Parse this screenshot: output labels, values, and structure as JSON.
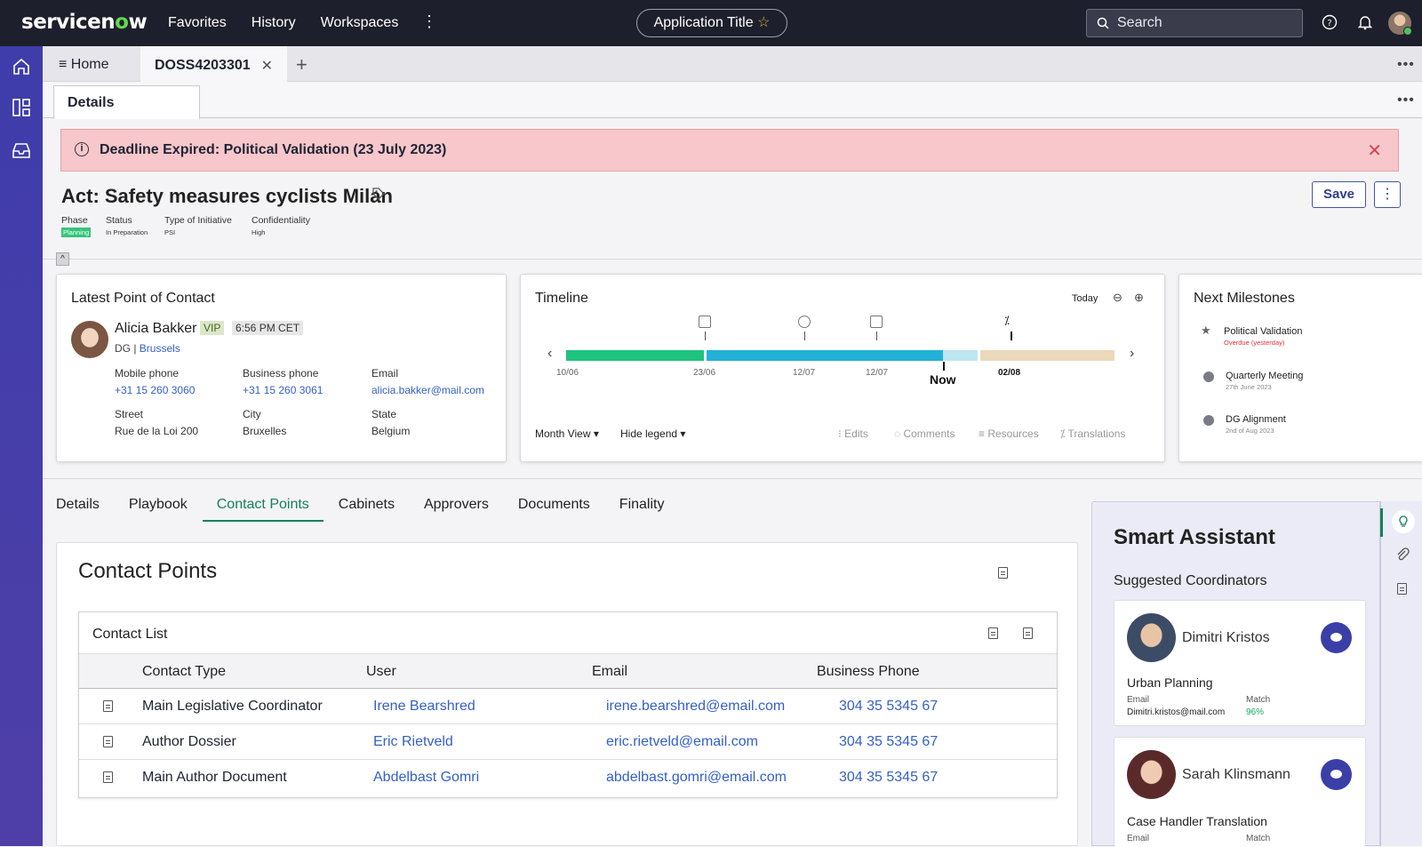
{
  "topbar": {
    "logo_a": "servicen",
    "logo_o": "o",
    "logo_b": "w",
    "nav": [
      "Favorites",
      "History",
      "Workspaces"
    ],
    "app_title": "Application Title",
    "search_placeholder": "Search"
  },
  "tabs": {
    "home": "Home",
    "doc": "DOSS4203301"
  },
  "subtab": "Details",
  "alert": "Deadline Expired: Political Validation (23 July 2023)",
  "act": {
    "title": "Act: Safety measures cyclists Milan",
    "save": "Save",
    "meta": [
      {
        "label": "Phase",
        "value": "Planning"
      },
      {
        "label": "Status",
        "value": "In Preparation"
      },
      {
        "label": "Type of Initiative",
        "value": "PSI"
      },
      {
        "label": "Confidentiality",
        "value": "High"
      }
    ]
  },
  "contact_card": {
    "title": "Latest Point of Contact",
    "name": "Alicia Bakker",
    "vip": "VIP",
    "time": "6:56 PM CET",
    "dept": "DG |",
    "city_link": "Brussels",
    "mobile_label": "Mobile phone",
    "mobile": "+31 15 260 3060",
    "business_label": "Business phone",
    "business": "+31 15 260 3061",
    "email_label": "Email",
    "email": "alicia.bakker@mail.com",
    "street_label": "Street",
    "street": "Rue de la Loi 200",
    "city_label": "City",
    "city": "Bruxelles",
    "state_label": "State",
    "state": "Belgium"
  },
  "timeline": {
    "title": "Timeline",
    "today": "Today",
    "dates": [
      "10/06",
      "23/06",
      "12/07",
      "12/07",
      "02/08"
    ],
    "now": "Now",
    "month_view": "Month View",
    "hide_legend": "Hide legend",
    "legend": [
      "Edits",
      "Comments",
      "Resources",
      "Translations"
    ],
    "colors": {
      "green": "#1ec47d",
      "blue": "#21b0d6",
      "light": "#bde6f0",
      "beige": "#ecd8bb"
    }
  },
  "milestones": {
    "title": "Next Milestones",
    "items": [
      {
        "name": "Political Validation",
        "date": "Overdue (yesterday)"
      },
      {
        "name": "Quarterly Meeting",
        "date": "27th June 2023"
      },
      {
        "name": "DG Alignment",
        "date": "2nd of Aug 2023"
      }
    ]
  },
  "section_tabs": [
    "Details",
    "Playbook",
    "Contact Points",
    "Cabinets",
    "Approvers",
    "Documents",
    "Finality"
  ],
  "contact_points": {
    "title": "Contact Points",
    "list_title": "Contact List",
    "headers": [
      "Contact Type",
      "User",
      "Email",
      "Business Phone"
    ],
    "rows": [
      {
        "type": "Main Legislative Coordinator",
        "user": "Irene Bearshred",
        "email": "irene.bearshred@email.com",
        "phone": "304 35 5345 67"
      },
      {
        "type": "Author Dossier",
        "user": "Eric Rietveld",
        "email": "eric.rietveld@email.com",
        "phone": "304 35 5345 67"
      },
      {
        "type": "Main Author Document",
        "user": "Abdelbast Gomri",
        "email": "abdelbast.gomri@email.com",
        "phone": "304 35 5345 67"
      }
    ]
  },
  "assistant": {
    "title": "Smart Assistant",
    "subtitle": "Suggested Coordinators",
    "people": [
      {
        "name": "Dimitri Kristos",
        "role": "Urban Planning",
        "email_label": "Email",
        "email": "Dimitri.kristos@mail.com",
        "match_label": "Match",
        "match": "96%"
      },
      {
        "name": "Sarah Klinsmann",
        "role": "Case Handler Translation",
        "email_label": "Email",
        "match_label": "Match"
      }
    ]
  }
}
